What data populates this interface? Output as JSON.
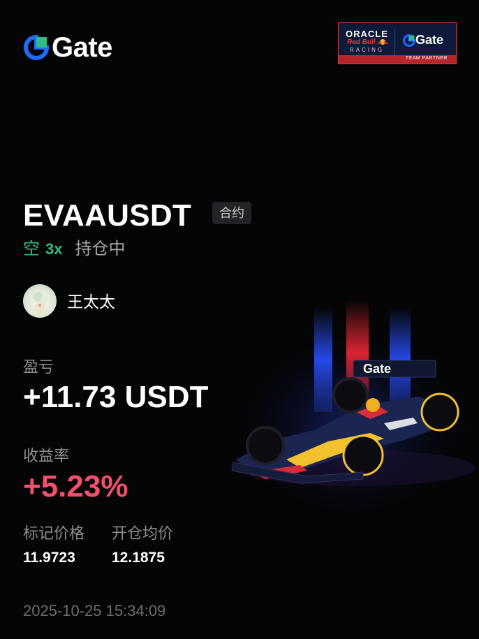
{
  "brand": {
    "logo_text": "Gate"
  },
  "partner_badge": {
    "oracle": "ORACLE",
    "redbull": "Red Bull",
    "racing": "RACING",
    "gate": "Gate",
    "team_partner": "TEAM PARTNER"
  },
  "position": {
    "symbol": "EVAAUSDT",
    "contract_tag": "合约",
    "side": "空",
    "leverage": "3x",
    "status": "持仓中"
  },
  "user": {
    "name": "王太太"
  },
  "pnl": {
    "label": "盈亏",
    "value": "+11.73 USDT"
  },
  "roi": {
    "label": "收益率",
    "value": "+5.23%"
  },
  "prices": {
    "mark_label": "标记价格",
    "mark_value": "11.9723",
    "entry_label": "开仓均价",
    "entry_value": "12.1875"
  },
  "timestamp": "2025-10-25 15:34:09",
  "colors": {
    "background": "#050505",
    "short": "#2ebd85",
    "roi_positive": "#f0506e",
    "brand_blue": "#1f6bff",
    "brand_green": "#2ebd85"
  },
  "icons": {
    "logo": "gate-logo-icon",
    "car": "f1-race-car-icon"
  }
}
